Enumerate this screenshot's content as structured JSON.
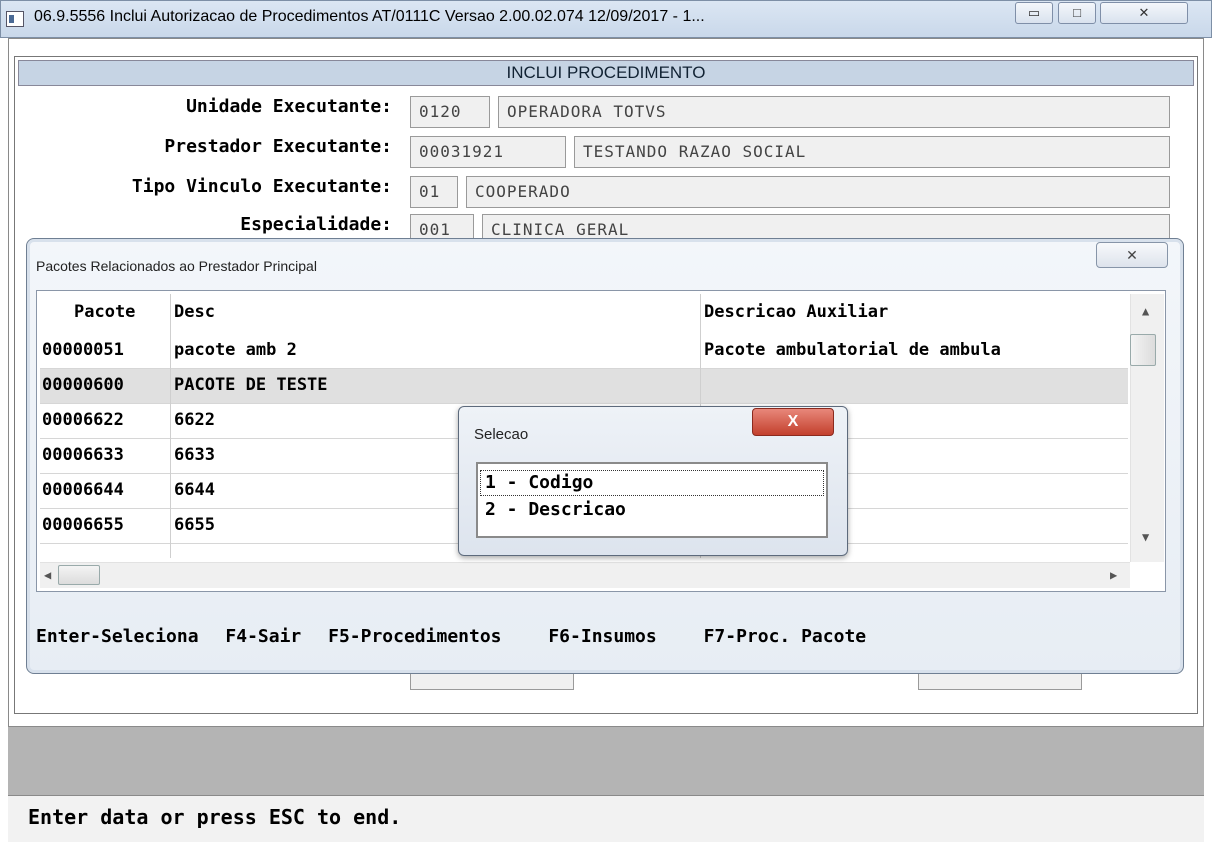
{
  "window": {
    "title": "06.9.5556   Inclui  Autorizacao de Procedimentos AT/0111C Versao 2.00.02.074 12/09/2017 - 1...",
    "min_glyph": "▭",
    "max_glyph": "□",
    "close_glyph": "✕"
  },
  "form": {
    "section_title": "INCLUI PROCEDIMENTO",
    "fields": [
      {
        "label": "Unidade Executante:",
        "code": "0120",
        "desc": "OPERADORA TOTVS"
      },
      {
        "label": "Prestador Executante:",
        "code": "00031921",
        "desc": "TESTANDO RAZAO SOCIAL"
      },
      {
        "label": "Tipo Vinculo Executante:",
        "code": "01",
        "desc": "COOPERADO"
      },
      {
        "label": "Especialidade:",
        "code": "001",
        "desc": "CLINICA GERAL"
      }
    ]
  },
  "pacotes": {
    "title": "Pacotes Relacionados ao Prestador Principal",
    "close_glyph": "✕",
    "columns": [
      "Pacote",
      "Desc",
      "Descricao Auxiliar"
    ],
    "rows": [
      {
        "pacote": "00000051",
        "desc": "pacote amb 2",
        "aux": "Pacote ambulatorial de ambula"
      },
      {
        "pacote": "00000600",
        "desc": "PACOTE DE TESTE",
        "aux": ""
      },
      {
        "pacote": "00006622",
        "desc": "6622",
        "aux": ""
      },
      {
        "pacote": "00006633",
        "desc": "6633",
        "aux": ""
      },
      {
        "pacote": "00006644",
        "desc": "6644",
        "aux": ""
      },
      {
        "pacote": "00006655",
        "desc": "6655",
        "aux": ""
      }
    ],
    "selected_row": 1,
    "hints": [
      "Enter-Seleciona",
      "F4-Sair",
      "F5-Procedimentos",
      "F6-Insumos",
      "F7-Proc. Pacote"
    ]
  },
  "selecao": {
    "title": "Selecao",
    "close_glyph": "X",
    "options": [
      "1 - Codigo",
      "2 - Descricao"
    ],
    "focused_option": 0
  },
  "status": {
    "message": "Enter data or press ESC to end."
  }
}
